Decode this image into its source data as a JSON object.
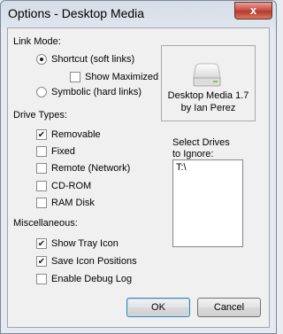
{
  "window": {
    "title": "Options - Desktop Media",
    "close_glyph": "x"
  },
  "link_mode": {
    "heading": "Link Mode:",
    "shortcut": {
      "label": "Shortcut (soft links)",
      "selected": true
    },
    "show_maximized": {
      "label": "Show Maximized",
      "checked": false
    },
    "symbolic": {
      "label": "Symbolic (hard links)",
      "selected": false
    }
  },
  "about": {
    "icon": "drive-icon",
    "product": "Desktop Media 1.7",
    "author": "by Ian Perez"
  },
  "drive_types": {
    "heading": "Drive Types:",
    "items": [
      {
        "label": "Removable",
        "checked": true
      },
      {
        "label": "Fixed",
        "checked": false
      },
      {
        "label": "Remote (Network)",
        "checked": false
      },
      {
        "label": "CD-ROM",
        "checked": false
      },
      {
        "label": "RAM Disk",
        "checked": false
      }
    ]
  },
  "ignore": {
    "label_line1": "Select Drives",
    "label_line2": "to Ignore:",
    "value": "T:\\"
  },
  "misc": {
    "heading": "Miscellaneous:",
    "items": [
      {
        "label": "Show Tray Icon",
        "checked": true
      },
      {
        "label": "Save Icon Positions",
        "checked": true
      },
      {
        "label": "Enable Debug Log",
        "checked": false
      }
    ]
  },
  "buttons": {
    "ok": "OK",
    "cancel": "Cancel"
  }
}
